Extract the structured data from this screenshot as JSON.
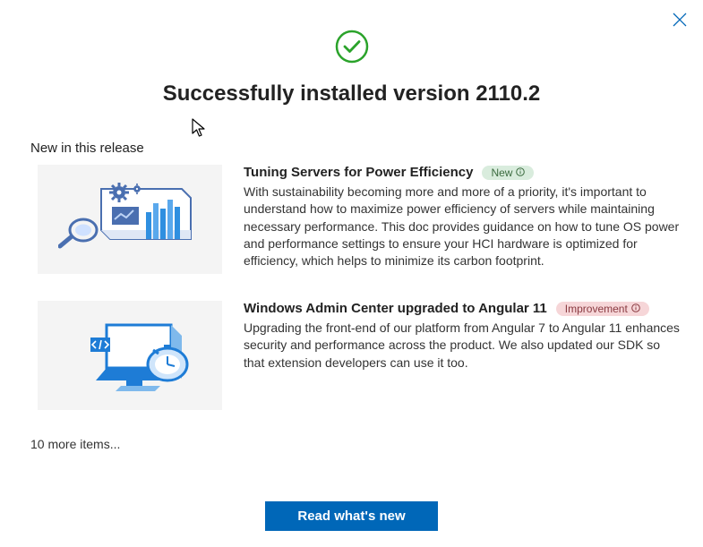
{
  "header": {
    "title": "Successfully installed version 2110.2",
    "subtitle": "New in this release"
  },
  "items": [
    {
      "title": "Tuning Servers for Power Efficiency",
      "badge": {
        "type": "new",
        "label": "New",
        "color": "#d9ecdd"
      },
      "description": "With sustainability becoming more and more of a priority, it's important to understand how to maximize power efficiency of servers while maintaining necessary performance. This doc provides guidance on how to tune OS power and performance settings to ensure your HCI hardware is optimized for efficiency, which helps to minimize its carbon footprint."
    },
    {
      "title": "Windows Admin Center upgraded to Angular 11",
      "badge": {
        "type": "improvement",
        "label": "Improvement",
        "color": "#f6d6d8"
      },
      "description": "Upgrading the front-end of our platform from Angular 7 to Angular 11 enhances security and performance across the product. We also updated our SDK so that extension developers can use it too."
    }
  ],
  "more_items_label": "10 more items...",
  "footer": {
    "cta_label": "Read what's new"
  },
  "colors": {
    "accent": "#0067b8",
    "success": "#2ba32b"
  }
}
